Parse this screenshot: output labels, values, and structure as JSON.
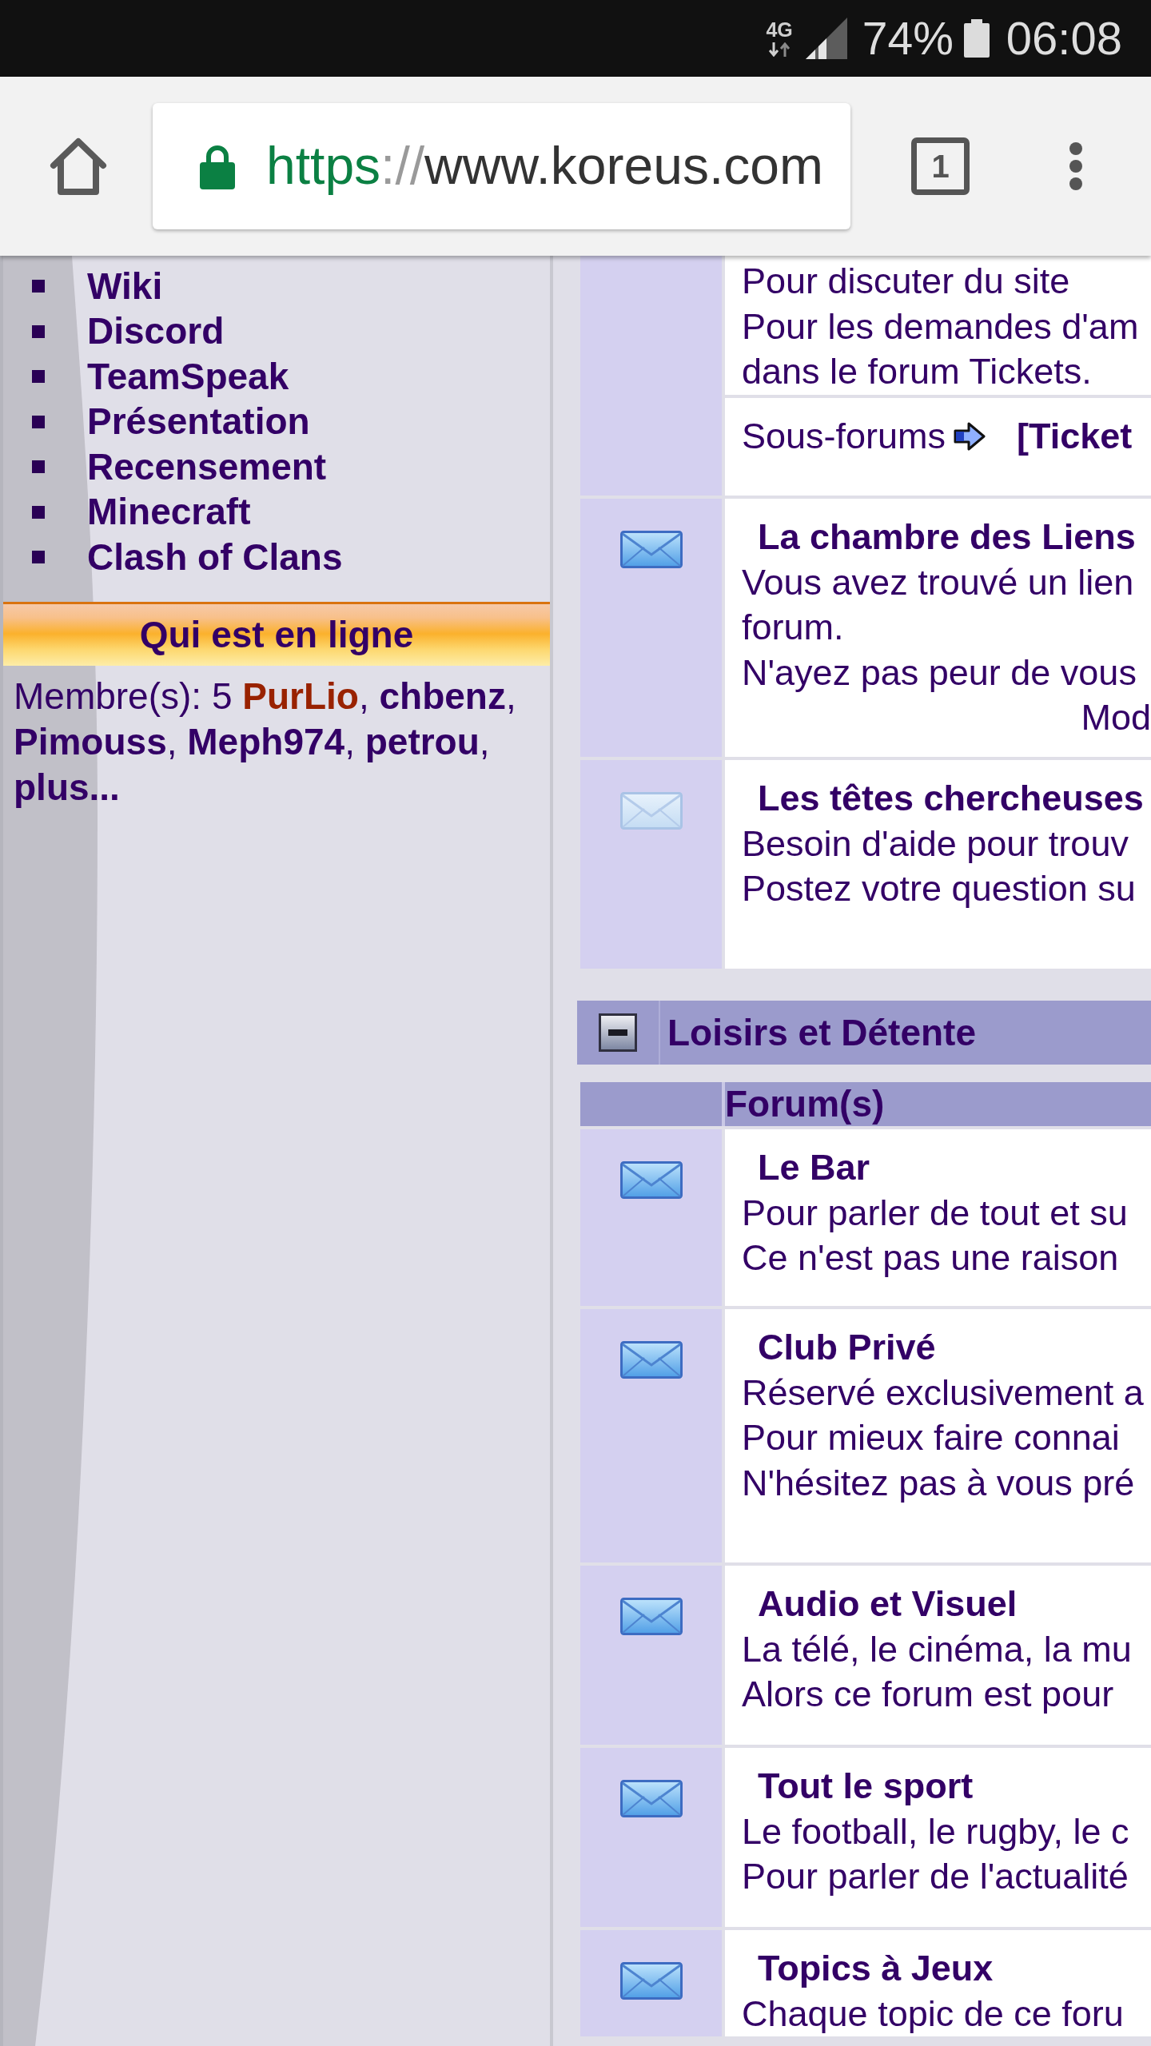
{
  "status_bar": {
    "network": "4G",
    "battery": "74%",
    "time": "06:08"
  },
  "browser": {
    "secure": true,
    "url": {
      "scheme": "https",
      "separator": "://",
      "host": "www.koreus.com"
    },
    "tab_count": "1"
  },
  "sidebar": {
    "links": [
      "Wiki",
      "Discord",
      "TeamSpeak",
      "Présentation",
      "Recensement",
      "Minecraft",
      "Clash of Clans"
    ]
  },
  "online": {
    "title": "Qui est en ligne",
    "label": "Membre(s): 5",
    "members": [
      {
        "name": "PurLio",
        "color": "#992200",
        "suffix": ","
      },
      {
        "name": "chbenz",
        "color": "#330066",
        "suffix": ","
      },
      {
        "name": "Pimouss",
        "color": "#330066",
        "suffix": ","
      },
      {
        "name": "Meph974",
        "color": "#330066",
        "suffix": ","
      },
      {
        "name": "petrou",
        "color": "#330066",
        "suffix": ","
      }
    ],
    "more": "plus..."
  },
  "forum_sections": [
    {
      "forums": [
        {
          "description": [
            "Pour discuter du site",
            "Pour les demandes d'am",
            "dans le forum Tickets."
          ],
          "subforums_label": "Sous-forums",
          "subforums": [
            "[Ticket"
          ]
        },
        {
          "unread": true,
          "title": "La chambre des Liens",
          "description": [
            "Vous avez trouvé un lien",
            "forum.",
            "N'ayez pas peur de vous"
          ],
          "moderators": "Mod"
        },
        {
          "unread": false,
          "title": "Les têtes chercheuses",
          "description": [
            "Besoin d'aide pour trouv",
            "Postez votre question su"
          ]
        }
      ]
    },
    {
      "title": "Loisirs et Détente",
      "expanded": true,
      "column_header": "Forum(s)",
      "forums": [
        {
          "unread": true,
          "title": "Le Bar",
          "description": [
            "Pour parler de tout et su",
            "Ce n'est pas une raison"
          ]
        },
        {
          "unread": true,
          "title": "Club Privé",
          "description": [
            "Réservé exclusivement a",
            "Pour mieux faire connai",
            "N'hésitez pas à vous pré"
          ]
        },
        {
          "unread": true,
          "title": "Audio et Visuel",
          "description": [
            "La télé, le cinéma, la mu",
            "Alors ce forum est pour"
          ]
        },
        {
          "unread": true,
          "title": "Tout le sport",
          "description": [
            "Le football, le rugby, le c",
            "Pour parler de l'actualité"
          ]
        },
        {
          "unread": true,
          "title": "Topics à Jeux",
          "description": [
            "Chaque topic de ce foru"
          ]
        }
      ]
    }
  ]
}
